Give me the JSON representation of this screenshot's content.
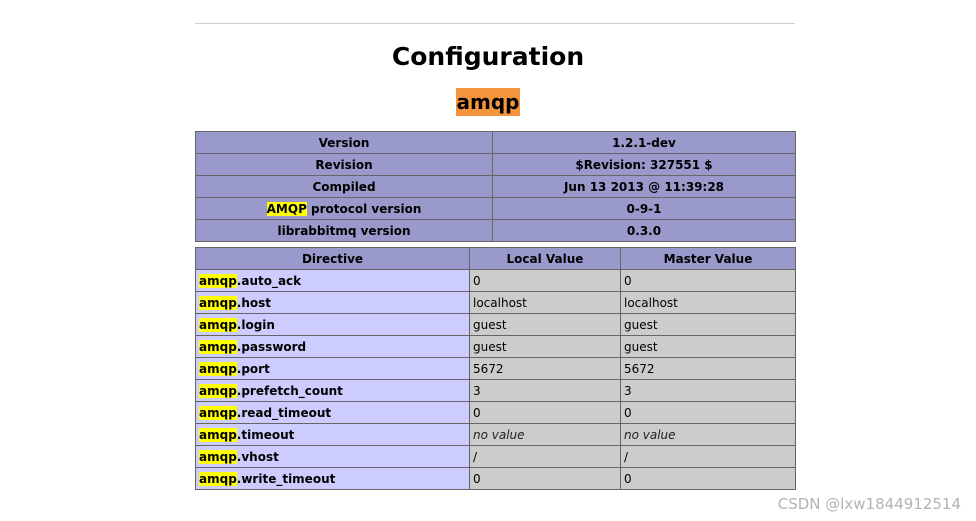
{
  "page_title": "Configuration",
  "module_name": "amqp",
  "info_rows": [
    {
      "label": "Version",
      "value": "1.2.1-dev"
    },
    {
      "label": "Revision",
      "value": "$Revision: 327551 $"
    },
    {
      "label": "Compiled",
      "value": "Jun 13 2013 @ 11:39:28"
    },
    {
      "label_highlight": "AMQP",
      "label_rest": " protocol version",
      "value": "0-9-1"
    },
    {
      "label": "librabbitmq version",
      "value": "0.3.0"
    }
  ],
  "directive_headers": [
    "Directive",
    "Local Value",
    "Master Value"
  ],
  "directives": [
    {
      "prefix": "amqp",
      "name": ".auto_ack",
      "local": "0",
      "master": "0"
    },
    {
      "prefix": "amqp",
      "name": ".host",
      "local": "localhost",
      "master": "localhost"
    },
    {
      "prefix": "amqp",
      "name": ".login",
      "local": "guest",
      "master": "guest"
    },
    {
      "prefix": "amqp",
      "name": ".password",
      "local": "guest",
      "master": "guest"
    },
    {
      "prefix": "amqp",
      "name": ".port",
      "local": "5672",
      "master": "5672"
    },
    {
      "prefix": "amqp",
      "name": ".prefetch_count",
      "local": "3",
      "master": "3"
    },
    {
      "prefix": "amqp",
      "name": ".read_timeout",
      "local": "0",
      "master": "0"
    },
    {
      "prefix": "amqp",
      "name": ".timeout",
      "local": "no value",
      "master": "no value"
    },
    {
      "prefix": "amqp",
      "name": ".vhost",
      "local": "/",
      "master": "/"
    },
    {
      "prefix": "amqp",
      "name": ".write_timeout",
      "local": "0",
      "master": "0"
    }
  ],
  "watermark": "CSDN @lxw1844912514"
}
